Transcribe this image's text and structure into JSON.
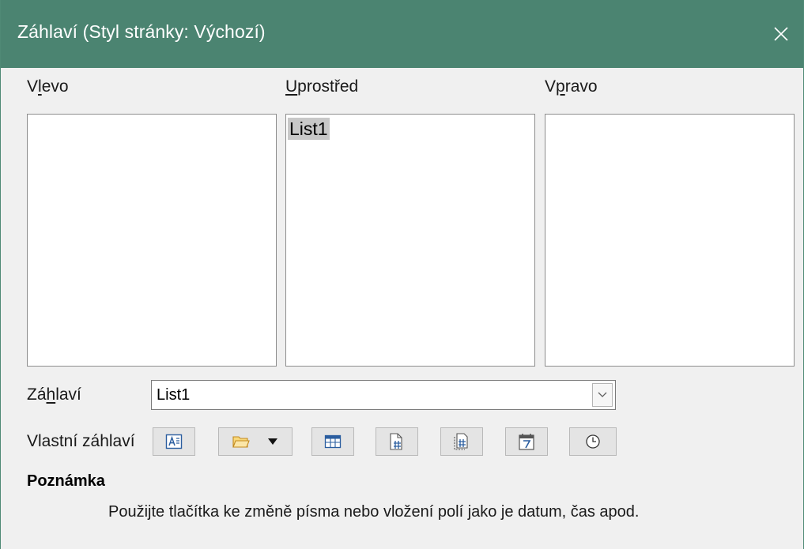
{
  "window": {
    "title": "Záhlaví (Styl stránky: Výchozí)",
    "close_icon": "close-icon"
  },
  "columns": {
    "left": {
      "pre": "V",
      "accel": "l",
      "post": "evo"
    },
    "center": {
      "pre": "",
      "accel": "U",
      "post": "prostřed",
      "selected_text": "List1"
    },
    "right": {
      "pre": "V",
      "accel": "p",
      "post": "ravo"
    }
  },
  "header_field": {
    "pre": "Zá",
    "accel": "h",
    "post": "laví",
    "value": "List1"
  },
  "custom_header": {
    "label": "Vlastní záhlaví",
    "buttons": [
      {
        "name": "text-attributes",
        "icon": "text-attributes-icon"
      },
      {
        "name": "file-name",
        "icon": "folder-icon",
        "has_dropdown": true
      },
      {
        "name": "sheet-name",
        "icon": "table-icon"
      },
      {
        "name": "page",
        "icon": "page-number-icon"
      },
      {
        "name": "pages",
        "icon": "page-count-icon"
      },
      {
        "name": "date",
        "icon": "calendar-icon"
      },
      {
        "name": "time",
        "icon": "clock-icon"
      }
    ]
  },
  "note": {
    "title": "Poznámka",
    "text": "Použijte tlačítka ke změně písma nebo vložení polí jako je datum, čas apod."
  },
  "colors": {
    "titlebar": "#4b8471",
    "background": "#f0f0f0",
    "selection": "#c8c8c8"
  }
}
